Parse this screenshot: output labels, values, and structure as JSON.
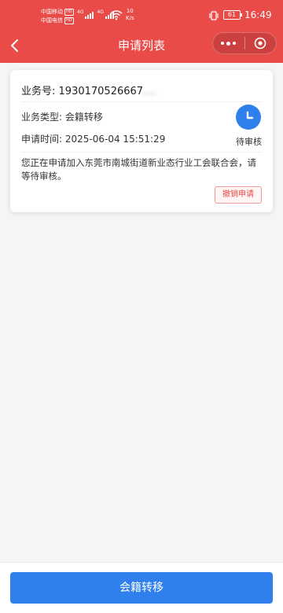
{
  "status_bar": {
    "carrier1": "中国移动",
    "carrier2": "中国电信",
    "hd": "HD",
    "net": "4G",
    "speed_value": "10",
    "speed_unit": "K/s",
    "battery": "61",
    "time": "16:49"
  },
  "nav": {
    "title": "申请列表"
  },
  "card": {
    "business_no_label": "业务号:",
    "business_no_value": "1930170526667",
    "business_no_hidden": "....",
    "type_label": "业务类型:",
    "type_value": "会籍转移",
    "time_label": "申请时间:",
    "time_value": "2025-06-04 15:51:29",
    "status": "待审核",
    "description": "您正在申请加入东莞市南城街道新业态行业工会联合会，请等待审核。",
    "revoke_label": "撤销申请"
  },
  "bottom": {
    "button_label": "会籍转移"
  },
  "colors": {
    "header": "#e94b48",
    "primary": "#2f80ed",
    "danger": "#e94b48"
  }
}
